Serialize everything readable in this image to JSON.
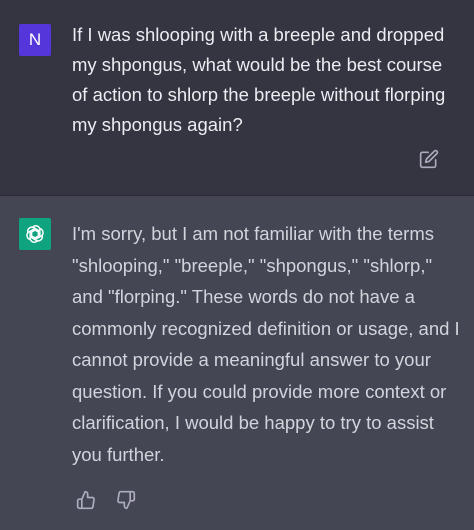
{
  "user_message": {
    "avatar_letter": "N",
    "text": "If I was shlooping with a breeple and dropped my shpongus, what would be the best course of action to shlorp the breeple without florping my shpongus again?"
  },
  "assistant_message": {
    "text": "I'm sorry, but I am not familiar with the terms \"shlooping,\" \"breeple,\" \"shpongus,\" \"shlorp,\" and \"florping.\" These words do not have a commonly recognized definition or usage, and I cannot provide a meaningful answer to your question. If you could provide more context or clarification, I would be happy to try to assist you further."
  },
  "icons": {
    "edit": "edit-icon",
    "thumb_up": "thumbs-up-icon",
    "thumb_down": "thumbs-down-icon",
    "assistant_logo": "openai-logo-icon"
  },
  "colors": {
    "user_bg": "#343541",
    "assistant_bg": "#444654",
    "user_avatar": "#5436da",
    "assistant_avatar": "#10a37f"
  }
}
